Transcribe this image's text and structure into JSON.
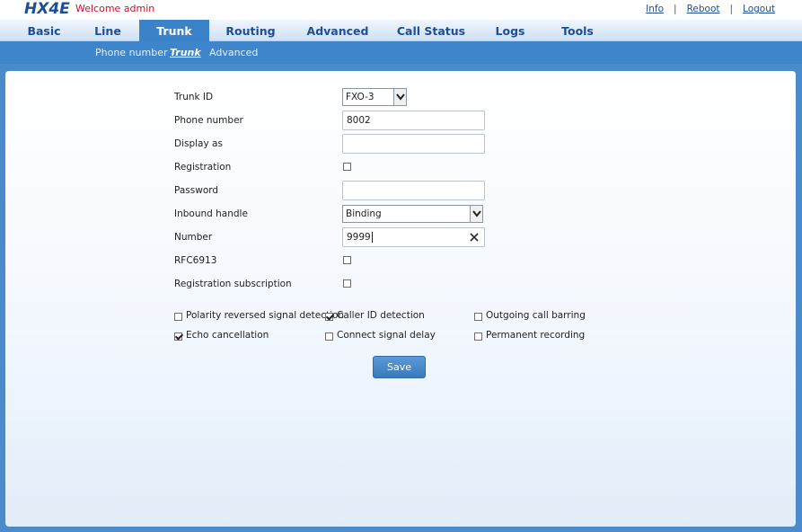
{
  "header": {
    "logo": "HX4E",
    "welcome": "Welcome admin",
    "links": [
      "Info",
      "Reboot",
      "Logout"
    ]
  },
  "nav": {
    "tabs": [
      "Basic",
      "Line",
      "Trunk",
      "Routing",
      "Advanced",
      "Call Status",
      "Logs",
      "Tools"
    ],
    "active": "Trunk"
  },
  "subnav": {
    "items": [
      "Phone number",
      "Trunk",
      "Advanced"
    ],
    "active": "Trunk"
  },
  "form": {
    "trunk_id": {
      "label": "Trunk ID",
      "value": "FXO-3"
    },
    "phone_number": {
      "label": "Phone number",
      "value": "8002"
    },
    "display_as": {
      "label": "Display as",
      "value": ""
    },
    "registration": {
      "label": "Registration",
      "checked": false
    },
    "password": {
      "label": "Password",
      "value": ""
    },
    "inbound_handle": {
      "label": "Inbound handle",
      "value": "Binding"
    },
    "number": {
      "label": "Number",
      "value": "9999"
    },
    "rfc6913": {
      "label": "RFC6913",
      "checked": false
    },
    "registration_subscription": {
      "label": "Registration subscription",
      "checked": false
    }
  },
  "options": {
    "polarity_reversed": {
      "label": "Polarity reversed signal detection",
      "checked": false
    },
    "caller_id": {
      "label": "Caller ID detection",
      "checked": true
    },
    "outgoing_barring": {
      "label": "Outgoing call barring",
      "checked": false
    },
    "echo_cancellation": {
      "label": "Echo cancellation",
      "checked": true
    },
    "connect_signal_delay": {
      "label": "Connect signal delay",
      "checked": false
    },
    "permanent_recording": {
      "label": "Permanent recording",
      "checked": false
    }
  },
  "buttons": {
    "save": "Save"
  },
  "icons": {
    "clear": "close-icon",
    "dropdown": "chevron-down-icon"
  },
  "colors": {
    "brand": "#1c4f96",
    "accent": "#3f85cb",
    "welcome": "#c8102e"
  }
}
